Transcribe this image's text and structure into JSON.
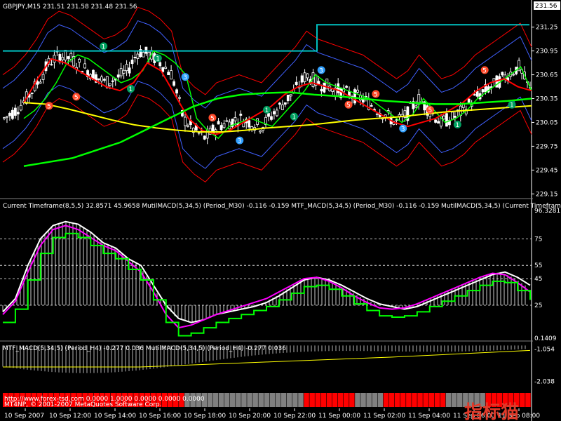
{
  "chart_data": [
    {
      "type": "line",
      "title": "GBPJPY,M15  231.51 231.58 231.48 231.56",
      "price_tag": "231.56",
      "ylim": [
        229.1,
        231.45
      ],
      "yticks": [
        "231.25",
        "230.95",
        "230.65",
        "230.35",
        "230.05",
        "229.75",
        "229.45",
        "229.15"
      ],
      "xticks": [
        "10 Sep 2007",
        "10 Sep 12:00",
        "10 Sep 14:00",
        "10 Sep 16:00",
        "10 Sep 18:00",
        "10 Sep 20:00",
        "10 Sep 22:00",
        "11 Sep 00:00",
        "11 Sep 02:00",
        "11 Sep 04:00",
        "11 Sep 06:00",
        "11 Sep 08:00"
      ],
      "x": [
        0,
        4,
        8,
        12,
        16,
        20,
        24,
        28,
        32,
        36,
        40,
        44,
        48,
        52,
        56,
        60,
        64,
        68,
        72,
        76,
        80,
        84,
        88,
        92,
        96,
        100,
        104,
        108,
        112,
        116,
        120,
        124,
        128,
        132,
        136,
        140,
        144,
        148,
        152,
        156,
        160,
        164,
        168,
        172,
        176,
        180,
        184,
        188
      ],
      "series": [
        {
          "values": [
            230.1,
            230.2,
            230.35,
            230.55,
            230.8,
            230.9,
            230.85,
            230.75,
            230.65,
            230.55,
            230.6,
            230.7,
            230.95,
            230.9,
            230.8,
            230.65,
            230.1,
            229.95,
            229.85,
            230.0,
            230.05,
            230.1,
            230.05,
            230.0,
            230.15,
            230.3,
            230.45,
            230.65,
            230.55,
            230.5,
            230.45,
            230.4,
            230.35,
            230.25,
            230.15,
            230.05,
            230.15,
            230.35,
            230.2,
            230.05,
            230.1,
            230.2,
            230.35,
            230.45,
            230.55,
            230.65,
            230.75,
            230.45
          ]
        },
        {
          "values": [
            230.3,
            230.6,
            230.85,
            230.8,
            230.7,
            230.6,
            230.5,
            230.45,
            230.55,
            230.8,
            230.7,
            230.4,
            230.1,
            229.95,
            229.9,
            229.95,
            230.05,
            230.15,
            230.25,
            230.4,
            230.5,
            230.55,
            230.5,
            230.45,
            230.35,
            230.25,
            230.15,
            230.05,
            230.0,
            230.05,
            230.1,
            230.2,
            230.3,
            230.45,
            230.55,
            230.6,
            230.5,
            230.45
          ]
        },
        {
          "values": [
            230.3,
            230.28,
            230.22,
            230.15,
            230.08,
            230.02,
            229.98,
            229.95,
            229.93,
            229.93,
            229.95,
            229.98,
            230.0,
            230.02,
            230.05,
            230.08,
            230.1,
            230.12,
            230.15,
            230.18,
            230.2,
            230.22,
            230.24,
            230.26
          ]
        },
        {
          "values": [
            229.5,
            229.55,
            229.6,
            229.7,
            229.8,
            229.95,
            230.1,
            230.25,
            230.35,
            230.4,
            230.42,
            230.43,
            230.4,
            230.38,
            230.35,
            230.32,
            230.3,
            230.28,
            230.28,
            230.3,
            230.32,
            230.35
          ]
        }
      ],
      "signals": [
        "5",
        "5",
        "1",
        "1",
        "1",
        "3",
        "5",
        "3",
        "1",
        "1",
        "3",
        "5",
        "5",
        "3",
        "5",
        "1",
        "5",
        "1"
      ]
    },
    {
      "type": "line",
      "label": "Current Timeframe(8,5,5) 32.8571 45.9658  MutilMACD(5,34,5) (Period_M30) -0.116 -0.159  MTF_MACD(5,34,5) (Period_M30) -0.116 -0.159  MutilMACD(5,34,5) (Current Timeframe",
      "ylim": [
        0.1409,
        96.3281
      ],
      "yticks": [
        "96.3281",
        "75",
        "55",
        "45",
        "25",
        "0.1409"
      ],
      "series": [
        {
          "values": [
            20,
            30,
            55,
            75,
            85,
            88,
            86,
            80,
            72,
            68,
            60,
            55,
            40,
            25,
            15,
            12,
            14,
            18,
            20,
            22,
            24,
            27,
            32,
            38,
            44,
            46,
            44,
            40,
            35,
            30,
            26,
            24,
            22,
            24,
            28,
            32,
            36,
            40,
            44,
            48,
            50,
            46,
            40
          ]
        },
        {
          "values": [
            18,
            28,
            50,
            70,
            82,
            85,
            82,
            76,
            70,
            66,
            58,
            50,
            35,
            18,
            8,
            10,
            14,
            18,
            21,
            24,
            27,
            30,
            35,
            40,
            45,
            46,
            43,
            38,
            32,
            27,
            23,
            22,
            23,
            26,
            30,
            34,
            38,
            42,
            46,
            49,
            48,
            42,
            35
          ]
        }
      ]
    },
    {
      "type": "bar",
      "label": "MTF_MACD(5,34,5) (Period_H4) -0.277 0.036  MutilMACD(5,34,5) (Period_H4) -0.277 0.036",
      "yticks": [
        "-1.054",
        "-2.038"
      ],
      "ylim": [
        -2.3,
        -0.9
      ]
    }
  ],
  "footer": {
    "link": "http://www.forex-tsd.com  0.0000  1.0000  0.0000  0.0000  0.0000",
    "copyright": "MT4NP, © 2001-2007 MetaQuotes Software Corp."
  },
  "watermark": "指标猫",
  "colors": {
    "background": "#000000",
    "grid": "#ffffff",
    "yellow": "#ffff00",
    "green": "#00ff00",
    "magenta": "#ff00ff",
    "red": "#ff0000",
    "blue": "#0000ff",
    "white": "#ffffff",
    "teal": "#00c0c0"
  }
}
